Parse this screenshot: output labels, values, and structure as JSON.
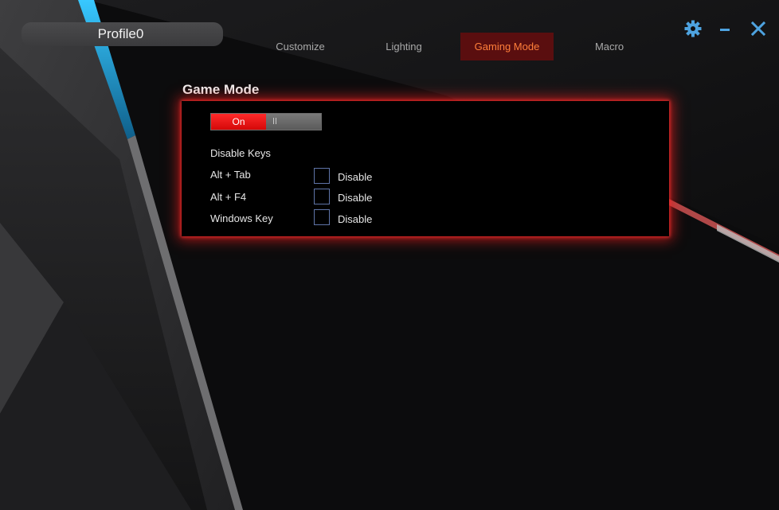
{
  "profile": {
    "name": "Profile0"
  },
  "tabs": [
    {
      "label": "Customize",
      "active": false
    },
    {
      "label": "Lighting",
      "active": false
    },
    {
      "label": "Gaming Mode",
      "active": true
    },
    {
      "label": "Macro",
      "active": false
    }
  ],
  "window_controls": {
    "settings_icon": "gear-icon",
    "minimize_icon": "minimize-icon",
    "close_icon": "close-icon",
    "icon_color": "#4ea3e0"
  },
  "game_mode": {
    "title": "Game Mode",
    "toggle": {
      "label": "On",
      "state": "on"
    },
    "disable_keys_heading": "Disable Keys",
    "keys": [
      {
        "name": "Alt + Tab",
        "option_label": "Disable",
        "checked": false
      },
      {
        "name": "Alt + F4",
        "option_label": "Disable",
        "checked": false
      },
      {
        "name": "Windows Key",
        "option_label": "Disable",
        "checked": false
      }
    ]
  },
  "colors": {
    "accent_red": "#e61b1b",
    "active_tab_bg": "#5a0e0f",
    "active_tab_text": "#ff7f3a",
    "accent_blue": "#2bb7f0"
  }
}
